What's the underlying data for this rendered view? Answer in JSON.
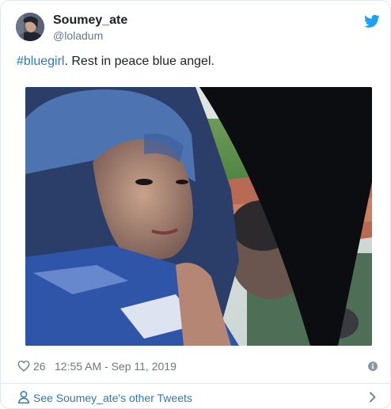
{
  "tweet": {
    "author_name": "Soumey_ate",
    "author_handle": "@loladum",
    "hashtag": "#bluegirl",
    "text_rest": ". Rest in peace blue angel.",
    "like_count": "26",
    "timestamp": "12:55 AM - Sep 11, 2019"
  },
  "footer": {
    "see_more_label": "See Soumey_ate's other Tweets"
  },
  "icons": {
    "brand": "twitter-bird-icon",
    "like": "heart-icon",
    "info": "info-icon",
    "profile": "person-icon",
    "more": "chevron-right-icon"
  },
  "colors": {
    "link": "#2b7bb9",
    "twitter_blue": "#1da1f2",
    "secondary_text": "#697882",
    "border": "#e1e8ed"
  }
}
